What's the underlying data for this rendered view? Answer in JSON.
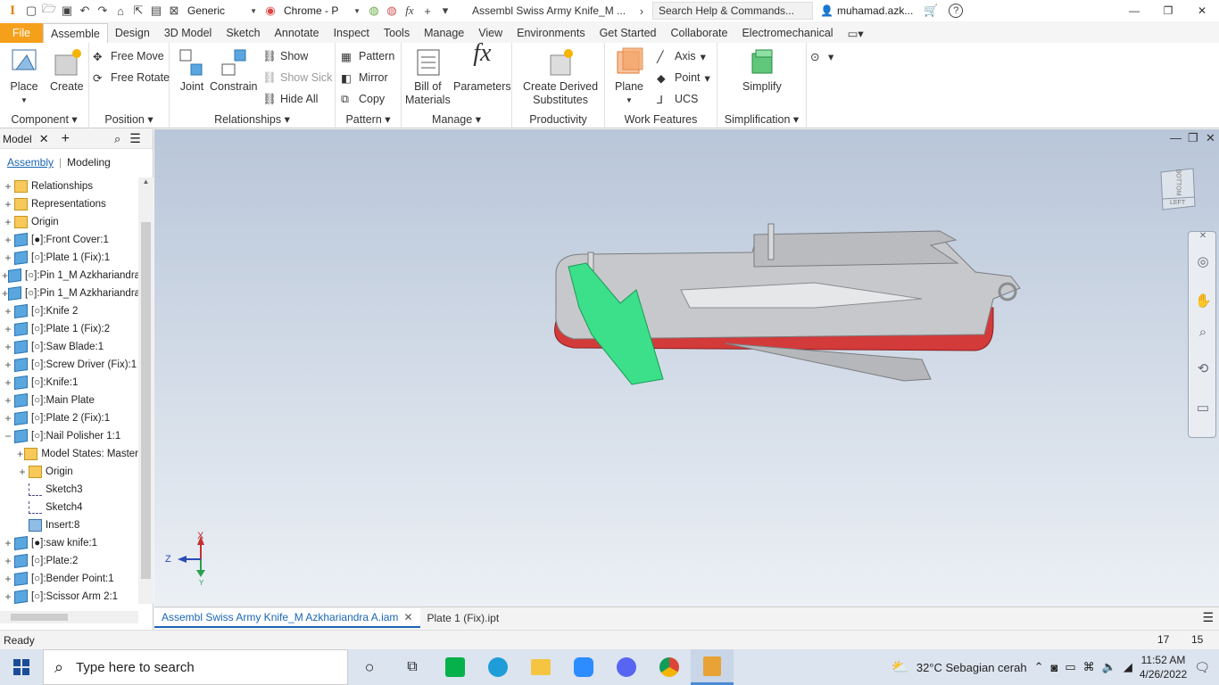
{
  "titlebar": {
    "logo": "I",
    "material_dd": "Generic",
    "appearance_dd": "Chrome - P",
    "fx": "fx",
    "doc_title": "Assembl Swiss Army Knife_M ...",
    "search_placeholder": "Search Help & Commands...",
    "user": "muhamad.azk...",
    "help": "?"
  },
  "tabs": [
    "File",
    "Assemble",
    "Design",
    "3D Model",
    "Sketch",
    "Annotate",
    "Inspect",
    "Tools",
    "Manage",
    "View",
    "Environments",
    "Get Started",
    "Collaborate",
    "Electromechanical"
  ],
  "ribbon": {
    "component": {
      "title": "Component",
      "place": "Place",
      "create": "Create"
    },
    "position": {
      "title": "Position",
      "free_move": "Free Move",
      "free_rotate": "Free Rotate"
    },
    "relationships": {
      "title": "Relationships",
      "joint": "Joint",
      "constrain": "Constrain",
      "show": "Show",
      "show_sick": "Show Sick",
      "hide_all": "Hide All"
    },
    "pattern": {
      "title": "Pattern",
      "pattern": "Pattern",
      "mirror": "Mirror",
      "copy": "Copy"
    },
    "manage": {
      "title": "Manage",
      "bom_1": "Bill of",
      "bom_2": "Materials",
      "parameters": "Parameters",
      "fx": "fx"
    },
    "productivity": {
      "title": "Productivity",
      "cds_1": "Create Derived",
      "cds_2": "Substitutes"
    },
    "work_features": {
      "title": "Work Features",
      "plane": "Plane",
      "axis": "Axis",
      "point": "Point",
      "ucs": "UCS"
    },
    "simplification": {
      "title": "Simplification",
      "simplify": "Simplify"
    }
  },
  "browser": {
    "title": "Model",
    "tab_assembly": "Assembly",
    "tab_modeling": "Modeling",
    "items": [
      {
        "label": "Relationships",
        "icon": "folder",
        "indent": 0,
        "exp": "+"
      },
      {
        "label": "Representations",
        "icon": "folder",
        "indent": 0,
        "exp": "+"
      },
      {
        "label": "Origin",
        "icon": "folder",
        "indent": 0,
        "exp": "+"
      },
      {
        "label": "[●]:Front Cover:1",
        "icon": "part",
        "indent": 0,
        "exp": "+"
      },
      {
        "label": "[○]:Plate 1 (Fix):1",
        "icon": "part",
        "indent": 0,
        "exp": "+"
      },
      {
        "label": "[○]:Pin 1_M Azkhariandra",
        "icon": "part",
        "indent": 0,
        "exp": "+"
      },
      {
        "label": "[○]:Pin 1_M Azkhariandra",
        "icon": "part",
        "indent": 0,
        "exp": "+"
      },
      {
        "label": "[○]:Knife 2",
        "icon": "part",
        "indent": 0,
        "exp": "+"
      },
      {
        "label": "[○]:Plate 1 (Fix):2",
        "icon": "part",
        "indent": 0,
        "exp": "+"
      },
      {
        "label": "[○]:Saw Blade:1",
        "icon": "part",
        "indent": 0,
        "exp": "+"
      },
      {
        "label": "[○]:Screw Driver (Fix):1",
        "icon": "part",
        "indent": 0,
        "exp": "+"
      },
      {
        "label": "[○]:Knife:1",
        "icon": "part",
        "indent": 0,
        "exp": "+"
      },
      {
        "label": "[○]:Main Plate",
        "icon": "part",
        "indent": 0,
        "exp": "+"
      },
      {
        "label": "[○]:Plate 2 (Fix):1",
        "icon": "part",
        "indent": 0,
        "exp": "+"
      },
      {
        "label": "[○]:Nail Polisher 1:1",
        "icon": "part",
        "indent": 0,
        "exp": "−"
      },
      {
        "label": "Model States: Master",
        "icon": "folder",
        "indent": 1,
        "exp": "+"
      },
      {
        "label": "Origin",
        "icon": "folder",
        "indent": 1,
        "exp": "+"
      },
      {
        "label": "Sketch3",
        "icon": "sketch",
        "indent": 1,
        "exp": ""
      },
      {
        "label": "Sketch4",
        "icon": "sketch",
        "indent": 1,
        "exp": ""
      },
      {
        "label": "Insert:8",
        "icon": "insert",
        "indent": 1,
        "exp": ""
      },
      {
        "label": "[●]:saw knife:1",
        "icon": "part",
        "indent": 0,
        "exp": "+"
      },
      {
        "label": "[○]:Plate:2",
        "icon": "part",
        "indent": 0,
        "exp": "+"
      },
      {
        "label": "[○]:Bender Point:1",
        "icon": "part",
        "indent": 0,
        "exp": "+"
      },
      {
        "label": "[○]:Scissor Arm 2:1",
        "icon": "part",
        "indent": 0,
        "exp": "+"
      }
    ]
  },
  "viewport": {
    "viewcube_top": "BOTTOM",
    "viewcube_left": "LEFT",
    "axis_x": "X",
    "axis_y": "Y",
    "axis_z": "Z"
  },
  "doctabs": {
    "active": "Assembl Swiss Army Knife_M Azkhariandra A.iam",
    "second": "Plate 1 (Fix).ipt"
  },
  "status": {
    "text": "Ready",
    "n1": "17",
    "n2": "15"
  },
  "taskbar": {
    "search_placeholder": "Type here to search",
    "weather": "32°C  Sebagian cerah",
    "time": "11:52 AM",
    "date": "4/26/2022"
  },
  "colors": {
    "accent": "#f5a01a",
    "blue": "#1a66b3",
    "green_part": "#3ce08a",
    "red_part": "#d33a3a"
  }
}
